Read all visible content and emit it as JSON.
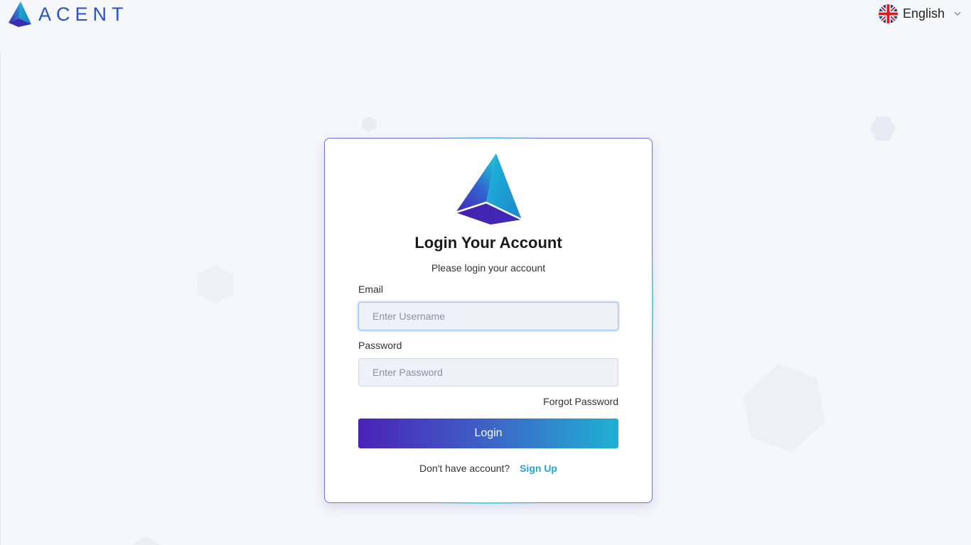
{
  "brand": {
    "name": "ACENT",
    "logo_icon": "acent-pyramid-logo"
  },
  "language": {
    "label": "English",
    "flag_icon": "uk-flag-icon",
    "chevron_icon": "chevron-down-icon"
  },
  "card": {
    "title": "Login Your Account",
    "subtitle": "Please login your account",
    "email": {
      "label": "Email",
      "placeholder": "Enter Username",
      "value": ""
    },
    "password": {
      "label": "Password",
      "placeholder": "Enter Password",
      "value": ""
    },
    "forgot_label": "Forgot Password",
    "login_label": "Login",
    "signup_prompt": "Don't have account?",
    "signup_label": "Sign Up"
  },
  "colors": {
    "brand_blue": "#2a52c9",
    "button_gradient_start": "#4a22b7",
    "button_gradient_end": "#1fb1d3",
    "link": "#22a6d4",
    "card_border": "#6e6fe0",
    "page_background": "#f6f7fb"
  }
}
